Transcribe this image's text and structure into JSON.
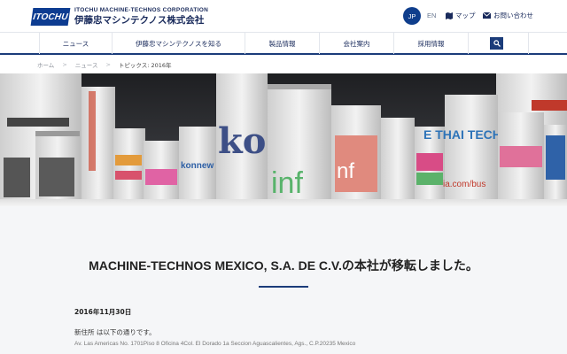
{
  "header": {
    "logo_mark": "ITOCHU",
    "company_en": "ITOCHU MACHINE-TECHNOS CORPORATION",
    "company_ja": "伊藤忠マシンテクノス株式会社",
    "lang_jp": "JP",
    "lang_en": "EN",
    "map_label": "マップ",
    "contact_label": "お問い合わせ"
  },
  "nav": {
    "items": [
      "ニュース",
      "伊藤忠マシンテクノスを知る",
      "製品情報",
      "会社案内",
      "採用情報"
    ]
  },
  "breadcrumb": [
    "ホーム",
    "ニュース",
    "トピックス: 2016年"
  ],
  "hero": {
    "labels": [
      "konnew",
      "ko",
      "inf",
      "nf",
      "E THAI TECH",
      "ia.com/bus"
    ]
  },
  "article": {
    "title": "MACHINE-TECHNOS MEXICO, S.A. DE C.V.の本社が移転しました。",
    "date": "2016年11月30日",
    "lead": "新住所 は以下の通りです。",
    "address": "Av. Las Americas No. 1701Piso 8 Oficina 4Col. El Dorado 1a Seccion Aguascalientes, Ags., C.P.20235 Mexico"
  },
  "colors": {
    "brand": "#1b3c7a",
    "content_bg": "#f5f6f8"
  }
}
